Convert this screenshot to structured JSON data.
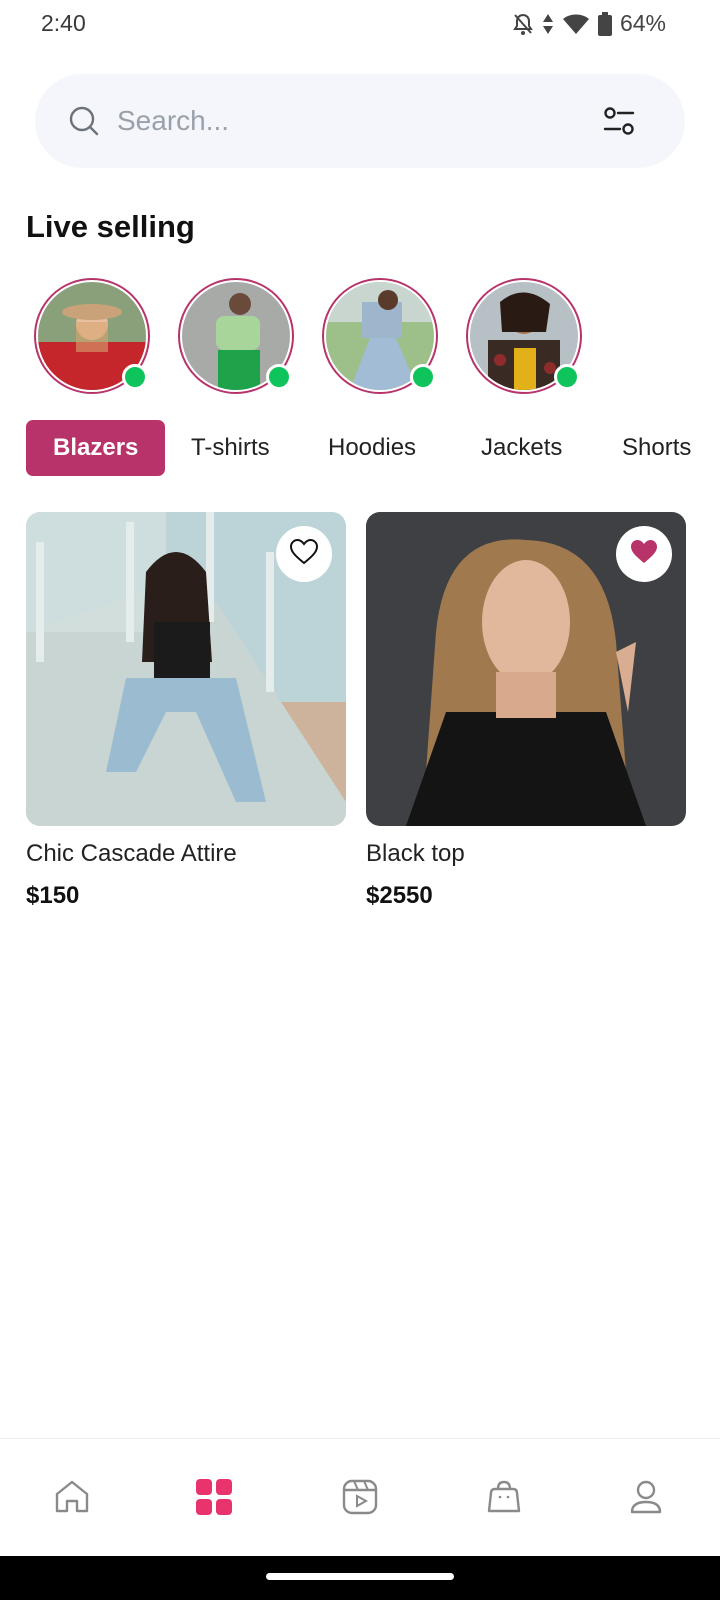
{
  "status_bar": {
    "time": "2:40",
    "battery_percent": "64%",
    "icons": [
      "notifications-off-icon",
      "data-arrows-icon",
      "wifi-icon",
      "battery-icon"
    ]
  },
  "search": {
    "placeholder": "Search...",
    "value": "",
    "icon": "search-icon",
    "filter_icon": "filter-icon"
  },
  "live_selling": {
    "title": "Live selling",
    "sellers": [
      {
        "image": "seller-photo-red-outfit-hat",
        "online": true
      },
      {
        "image": "seller-photo-green-outfit",
        "online": true
      },
      {
        "image": "seller-photo-blue-dress",
        "online": true
      },
      {
        "image": "seller-photo-patterned-jacket",
        "online": true
      }
    ]
  },
  "categories": {
    "selected": "Blazers",
    "items": [
      "Blazers",
      "T-shirts",
      "Hoodies",
      "Jackets",
      "Shorts"
    ]
  },
  "products": [
    {
      "name": "Chic Cascade Attire",
      "price": "$150",
      "favorited": false,
      "image": "product-photo-woman-lifeguard-stand"
    },
    {
      "name": "Black top",
      "price": "$2550",
      "favorited": true,
      "image": "product-photo-woman-black-top"
    }
  ],
  "bottom_nav": {
    "active": "grid",
    "items": [
      "home-icon",
      "grid-icon",
      "reels-icon",
      "bag-icon",
      "profile-icon"
    ]
  },
  "colors": {
    "accent": "#b8336a",
    "online": "#10c45c",
    "search_bg": "#f4f6fb",
    "nav_active": "#e8336d"
  }
}
